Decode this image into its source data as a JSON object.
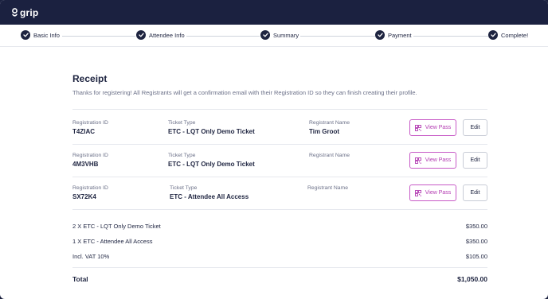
{
  "app": {
    "logo_text": "grip"
  },
  "stepper": {
    "steps": [
      {
        "label": "Basic Info"
      },
      {
        "label": "Attendee Info"
      },
      {
        "label": "Summary"
      },
      {
        "label": "Payment"
      },
      {
        "label": "Complete!"
      }
    ]
  },
  "receipt": {
    "title": "Receipt",
    "subtitle": "Thanks for registering! All Registrants will get a confirmation email with their Registration ID so they can finish creating their profile.",
    "labels": {
      "registration_id": "Registration ID",
      "ticket_type": "Ticket Type",
      "registrant_name": "Registrant Name"
    },
    "buttons": {
      "view_pass": "View Pass",
      "edit": "Edit"
    },
    "registrations": [
      {
        "registration_id": "T4ZIAC",
        "ticket_type": "ETC - LQT Only Demo Ticket",
        "registrant_name": "Tim Groot"
      },
      {
        "registration_id": "4M3VHB",
        "ticket_type": "ETC - LQT Only Demo Ticket",
        "registrant_name": ""
      },
      {
        "registration_id": "SX72K4",
        "ticket_type": "ETC - Attendee All Access",
        "registrant_name": ""
      }
    ],
    "summary": [
      {
        "item": "2 X ETC - LQT Only Demo Ticket",
        "amount": "$350.00"
      },
      {
        "item": "1 X ETC - Attendee All Access",
        "amount": "$350.00"
      },
      {
        "item": "Incl. VAT 10%",
        "amount": "$105.00"
      }
    ],
    "total": {
      "label": "Total",
      "amount": "$1,050.00"
    }
  },
  "colors": {
    "navy": "#1b2140",
    "accent": "#b33bb2"
  }
}
